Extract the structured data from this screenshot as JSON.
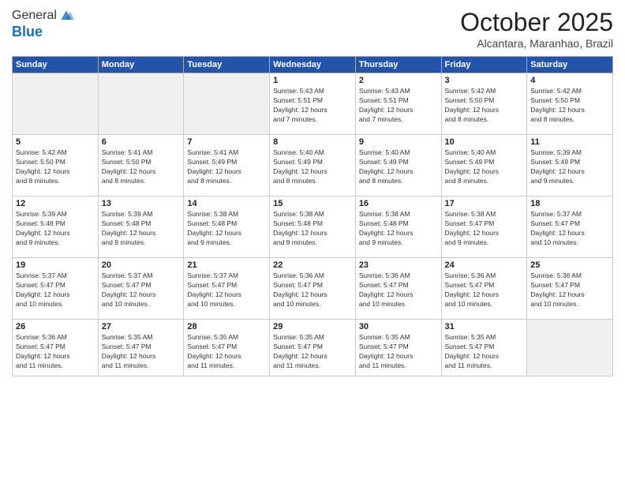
{
  "logo": {
    "general": "General",
    "blue": "Blue"
  },
  "header": {
    "title": "October 2025",
    "subtitle": "Alcantara, Maranhao, Brazil"
  },
  "weekdays": [
    "Sunday",
    "Monday",
    "Tuesday",
    "Wednesday",
    "Thursday",
    "Friday",
    "Saturday"
  ],
  "weeks": [
    [
      {
        "day": "",
        "content": ""
      },
      {
        "day": "",
        "content": ""
      },
      {
        "day": "",
        "content": ""
      },
      {
        "day": "1",
        "content": "Sunrise: 5:43 AM\nSunset: 5:51 PM\nDaylight: 12 hours\nand 7 minutes."
      },
      {
        "day": "2",
        "content": "Sunrise: 5:43 AM\nSunset: 5:51 PM\nDaylight: 12 hours\nand 7 minutes."
      },
      {
        "day": "3",
        "content": "Sunrise: 5:42 AM\nSunset: 5:50 PM\nDaylight: 12 hours\nand 8 minutes."
      },
      {
        "day": "4",
        "content": "Sunrise: 5:42 AM\nSunset: 5:50 PM\nDaylight: 12 hours\nand 8 minutes."
      }
    ],
    [
      {
        "day": "5",
        "content": "Sunrise: 5:42 AM\nSunset: 5:50 PM\nDaylight: 12 hours\nand 8 minutes."
      },
      {
        "day": "6",
        "content": "Sunrise: 5:41 AM\nSunset: 5:50 PM\nDaylight: 12 hours\nand 8 minutes."
      },
      {
        "day": "7",
        "content": "Sunrise: 5:41 AM\nSunset: 5:49 PM\nDaylight: 12 hours\nand 8 minutes."
      },
      {
        "day": "8",
        "content": "Sunrise: 5:40 AM\nSunset: 5:49 PM\nDaylight: 12 hours\nand 8 minutes."
      },
      {
        "day": "9",
        "content": "Sunrise: 5:40 AM\nSunset: 5:49 PM\nDaylight: 12 hours\nand 8 minutes."
      },
      {
        "day": "10",
        "content": "Sunrise: 5:40 AM\nSunset: 5:49 PM\nDaylight: 12 hours\nand 8 minutes."
      },
      {
        "day": "11",
        "content": "Sunrise: 5:39 AM\nSunset: 5:49 PM\nDaylight: 12 hours\nand 9 minutes."
      }
    ],
    [
      {
        "day": "12",
        "content": "Sunrise: 5:39 AM\nSunset: 5:48 PM\nDaylight: 12 hours\nand 9 minutes."
      },
      {
        "day": "13",
        "content": "Sunrise: 5:39 AM\nSunset: 5:48 PM\nDaylight: 12 hours\nand 9 minutes."
      },
      {
        "day": "14",
        "content": "Sunrise: 5:38 AM\nSunset: 5:48 PM\nDaylight: 12 hours\nand 9 minutes."
      },
      {
        "day": "15",
        "content": "Sunrise: 5:38 AM\nSunset: 5:48 PM\nDaylight: 12 hours\nand 9 minutes."
      },
      {
        "day": "16",
        "content": "Sunrise: 5:38 AM\nSunset: 5:48 PM\nDaylight: 12 hours\nand 9 minutes."
      },
      {
        "day": "17",
        "content": "Sunrise: 5:38 AM\nSunset: 5:47 PM\nDaylight: 12 hours\nand 9 minutes."
      },
      {
        "day": "18",
        "content": "Sunrise: 5:37 AM\nSunset: 5:47 PM\nDaylight: 12 hours\nand 10 minutes."
      }
    ],
    [
      {
        "day": "19",
        "content": "Sunrise: 5:37 AM\nSunset: 5:47 PM\nDaylight: 12 hours\nand 10 minutes."
      },
      {
        "day": "20",
        "content": "Sunrise: 5:37 AM\nSunset: 5:47 PM\nDaylight: 12 hours\nand 10 minutes."
      },
      {
        "day": "21",
        "content": "Sunrise: 5:37 AM\nSunset: 5:47 PM\nDaylight: 12 hours\nand 10 minutes."
      },
      {
        "day": "22",
        "content": "Sunrise: 5:36 AM\nSunset: 5:47 PM\nDaylight: 12 hours\nand 10 minutes."
      },
      {
        "day": "23",
        "content": "Sunrise: 5:36 AM\nSunset: 5:47 PM\nDaylight: 12 hours\nand 10 minutes."
      },
      {
        "day": "24",
        "content": "Sunrise: 5:36 AM\nSunset: 5:47 PM\nDaylight: 12 hours\nand 10 minutes."
      },
      {
        "day": "25",
        "content": "Sunrise: 5:36 AM\nSunset: 5:47 PM\nDaylight: 12 hours\nand 10 minutes."
      }
    ],
    [
      {
        "day": "26",
        "content": "Sunrise: 5:36 AM\nSunset: 5:47 PM\nDaylight: 12 hours\nand 11 minutes."
      },
      {
        "day": "27",
        "content": "Sunrise: 5:35 AM\nSunset: 5:47 PM\nDaylight: 12 hours\nand 11 minutes."
      },
      {
        "day": "28",
        "content": "Sunrise: 5:35 AM\nSunset: 5:47 PM\nDaylight: 12 hours\nand 11 minutes."
      },
      {
        "day": "29",
        "content": "Sunrise: 5:35 AM\nSunset: 5:47 PM\nDaylight: 12 hours\nand 11 minutes."
      },
      {
        "day": "30",
        "content": "Sunrise: 5:35 AM\nSunset: 5:47 PM\nDaylight: 12 hours\nand 11 minutes."
      },
      {
        "day": "31",
        "content": "Sunrise: 5:35 AM\nSunset: 5:47 PM\nDaylight: 12 hours\nand 11 minutes."
      },
      {
        "day": "",
        "content": ""
      }
    ]
  ]
}
